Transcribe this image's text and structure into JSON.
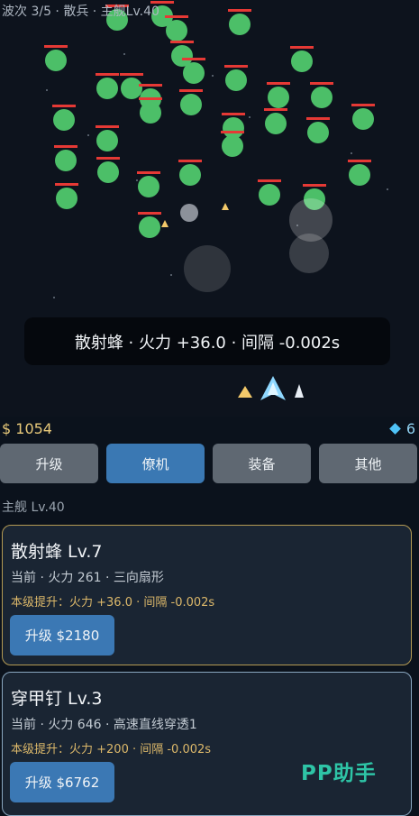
{
  "hud": {
    "wave_status": "波次 3/5 · 散兵 · 主舰Lv.40",
    "toast": "散射蜂 · 火力 +36.0 · 间隔 -0.002s",
    "gold": "$ 1054",
    "gems": "6"
  },
  "tabs": [
    {
      "label": "升级",
      "active": false
    },
    {
      "label": "僚机",
      "active": true
    },
    {
      "label": "装备",
      "active": false
    },
    {
      "label": "其他",
      "active": false
    }
  ],
  "ship_level": "主舰 Lv.40",
  "cards": [
    {
      "title": "散射蜂   Lv.7",
      "current": "当前 · 火力 261 · 三向扇形",
      "next": "本级提升：火力 +36.0 · 间隔 -0.002s",
      "button": "升级 $2180"
    },
    {
      "title": "穿甲钉   Lv.3",
      "current": "当前 · 火力 646 · 高速直线穿透1",
      "next": "本级提升：火力 +200 · 间隔 -0.002s",
      "button": "升级 $6762"
    }
  ],
  "watermark": "PP助手",
  "colors": {
    "enemy": "#4cbf68",
    "health_bar": "#e53935",
    "tab_active": "#3a78b3",
    "tab_inactive": "#5f6872",
    "gold": "#e8c97a",
    "gem": "#4fc3f7"
  }
}
